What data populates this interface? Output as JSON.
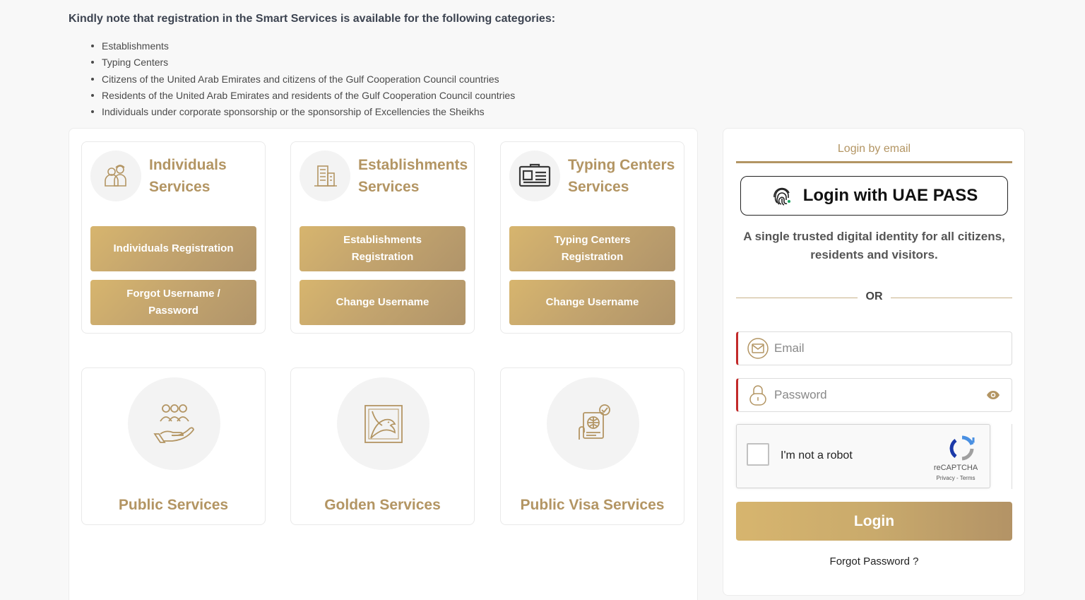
{
  "notice": {
    "title": "Kindly note that registration in the Smart Services is available for the following categories:",
    "items": [
      "Establishments",
      "Typing Centers",
      "Citizens of the United Arab Emirates and citizens of the Gulf Cooperation Council countries",
      "Residents of the United Arab Emirates and residents of the Gulf Cooperation Council countries",
      "Individuals under corporate sponsorship or the sponsorship of Excellencies the Sheikhs"
    ]
  },
  "cards": [
    {
      "title": "Individuals Services",
      "icon": "individuals-icon",
      "buttons": [
        "Individuals Registration",
        "Forgot Username / Password"
      ]
    },
    {
      "title": "Establishments Services",
      "icon": "building-icon",
      "buttons": [
        "Establishments Registration",
        "Change Username"
      ]
    },
    {
      "title": "Typing Centers Services",
      "icon": "id-card-icon",
      "buttons": [
        "Typing Centers Registration",
        "Change Username"
      ]
    }
  ],
  "service_tiles": [
    {
      "title": "Public Services",
      "icon": "people-hand-icon"
    },
    {
      "title": "Golden Services",
      "icon": "falcon-icon"
    },
    {
      "title": "Public Visa Services",
      "icon": "visa-icon"
    }
  ],
  "login": {
    "tab_label": "Login by email",
    "uaepass_label": "Login with UAE PASS",
    "uaepass_desc": "A single trusted digital identity for all citizens, residents and visitors.",
    "or_text": "OR",
    "email_placeholder": "Email",
    "password_placeholder": "Password",
    "captcha_text": "I'm not a robot",
    "captcha_brand": "reCAPTCHA",
    "captcha_terms": "Privacy - Terms",
    "login_button": "Login",
    "forgot_password": "Forgot Password ?"
  },
  "colors": {
    "gold": "#b39563",
    "gold_light": "#d7b56e",
    "error_border": "#c22a2a"
  }
}
